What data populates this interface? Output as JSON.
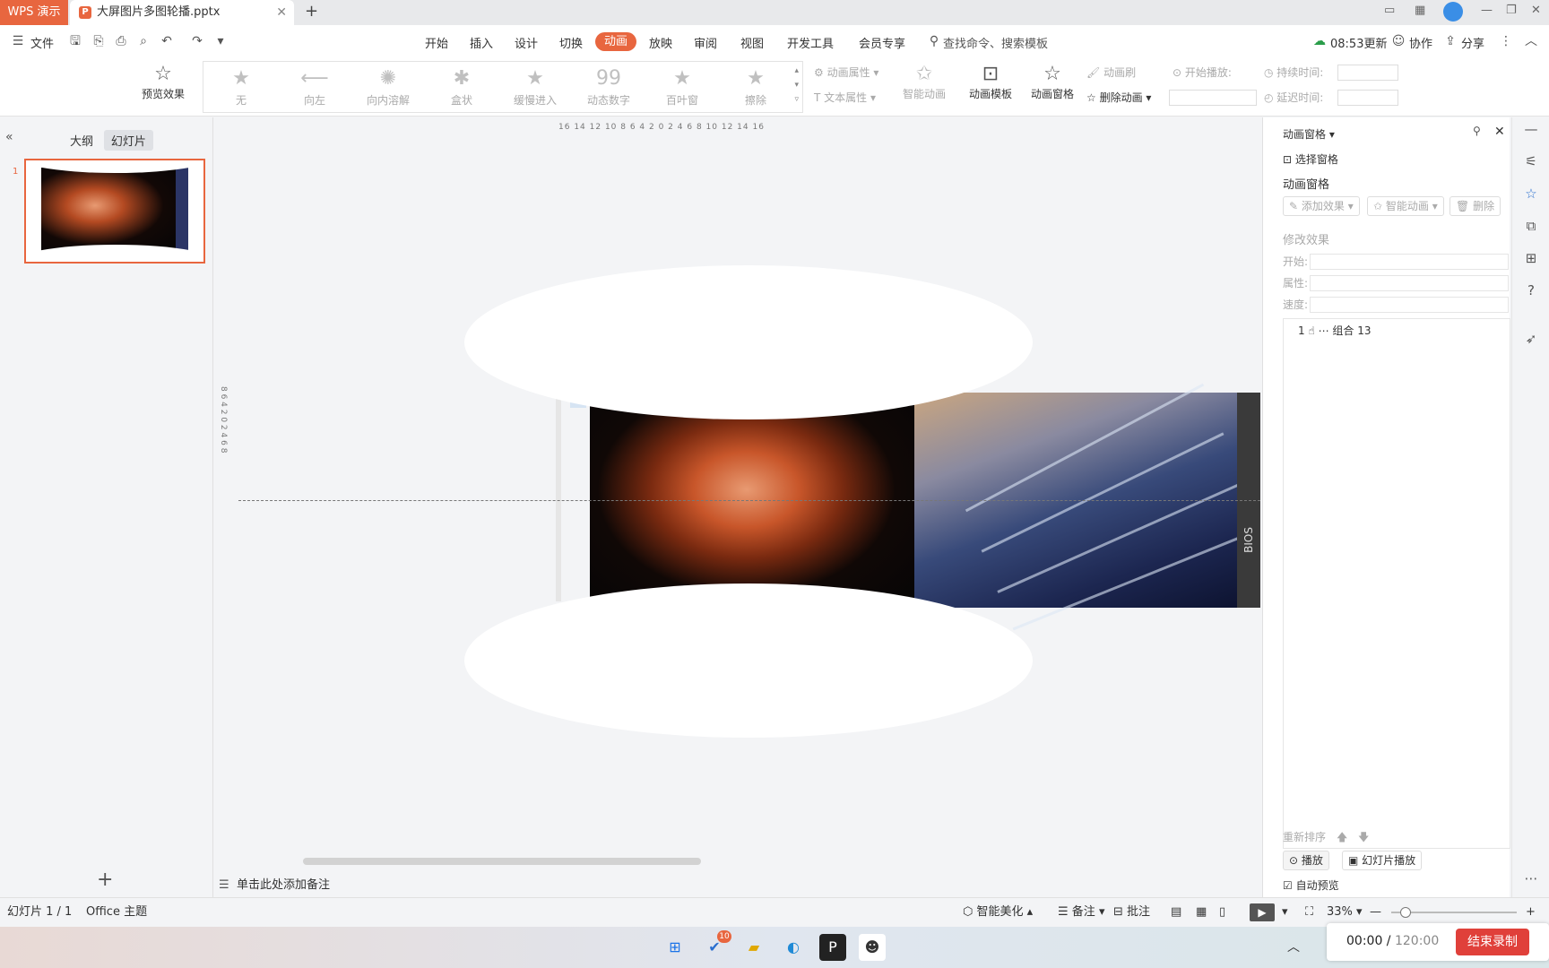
{
  "titlebar": {
    "app_tab": "WPS 演示",
    "doc_tab": "大屏图片多图轮播.pptx",
    "close": "✕",
    "new_tab": "+"
  },
  "menubar": {
    "file": "文件",
    "tabs": [
      "开始",
      "插入",
      "设计",
      "切换",
      "动画",
      "放映",
      "审阅",
      "视图",
      "开发工具",
      "会员专享"
    ],
    "active_tab": "动画",
    "search": "查找命令、搜索模板",
    "update": "08:53更新",
    "collab": "协作",
    "share": "分享"
  },
  "ribbon": {
    "preview": "预览效果",
    "gallery": [
      "无",
      "向左",
      "向内溶解",
      "盒状",
      "缓慢进入",
      "动态数字",
      "百叶窗",
      "擦除"
    ],
    "anim_props": "动画属性",
    "text_props": "文本属性",
    "smart_anim": "智能动画",
    "anim_template": "动画模板",
    "anim_pane": "动画窗格",
    "anim_brush": "动画刷",
    "delete_anim": "删除动画",
    "start_play": "开始播放:",
    "duration": "持续时间:",
    "delay": "延迟时间:"
  },
  "leftpanel": {
    "tabs": [
      "大纲",
      "幻灯片"
    ],
    "active_tab": "幻灯片",
    "slide_number": "1",
    "add": "+"
  },
  "canvas": {
    "ruler_h": "16 14 12 10 8 6 4 2 0 2 4 6 8 10 12 14 16",
    "ruler_v": "8 6 4 2 0 2 4 6 8",
    "slide_tag": "1",
    "side_text": "BIOS"
  },
  "notes": {
    "placeholder": "单击此处添加备注"
  },
  "rightpanel": {
    "header": "动画窗格",
    "select_pane": "选择窗格",
    "title": "动画窗格",
    "add_effect": "添加效果",
    "smart_anim": "智能动画",
    "delete": "删除",
    "modify": "修改效果",
    "start": "开始:",
    "props": "属性:",
    "speed": "速度:",
    "list_item": "1 ☝ ⋯ 组合 13",
    "reorder": "重新排序",
    "play": "播放",
    "slideshow": "幻灯片播放",
    "autopreview": "自动预览"
  },
  "statusbar": {
    "slide": "幻灯片 1 / 1",
    "theme": "Office 主题",
    "beautify": "智能美化",
    "notes": "备注",
    "comment": "批注",
    "zoom": "33%"
  },
  "taskbar": {
    "badge": "10"
  },
  "recorder": {
    "elapsed": "00:00",
    "total": "120:00",
    "stop": "结束录制"
  }
}
